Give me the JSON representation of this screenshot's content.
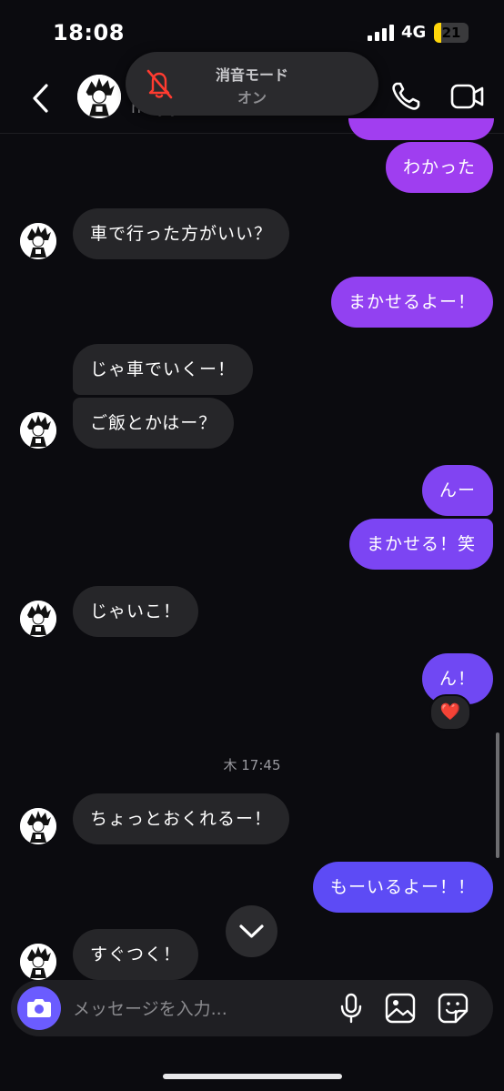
{
  "status_bar": {
    "time": "18:08",
    "network": "4G",
    "battery": "21",
    "battery_level": 0.21,
    "battery_color": "#ffd60a"
  },
  "header": {
    "username": "m..y.y",
    "toast_title": "消音モード",
    "toast_subtitle": "オン"
  },
  "colors": {
    "outgoing_top": "#a13ef0",
    "outgoing_bottom": "#5a4cf5",
    "incoming": "#262629",
    "accent": "#6b5cff",
    "muted_icon": "#ff3b30"
  },
  "messages": {
    "m1": "わかった",
    "m2": "車で行った方がいい？",
    "m3": "まかせるよー！",
    "m4": "じゃ車でいくー！",
    "m5": "ご飯とかはー？",
    "m6": "んー",
    "m7": "まかせる！笑",
    "m8": "じゃいこ！",
    "m9": "ん！",
    "m10": "ちょっとおくれるー！",
    "m11": "もーいるよー！！",
    "m12": "すぐつく！"
  },
  "reaction": "❤️",
  "timestamp": "木 17:45",
  "composer": {
    "placeholder": "メッセージを入力..."
  },
  "icons": [
    "back-chevron-icon",
    "phone-icon",
    "video-camera-icon",
    "muted-bell-icon",
    "chevron-down-icon",
    "camera-icon",
    "microphone-icon",
    "gallery-icon",
    "sticker-icon"
  ]
}
